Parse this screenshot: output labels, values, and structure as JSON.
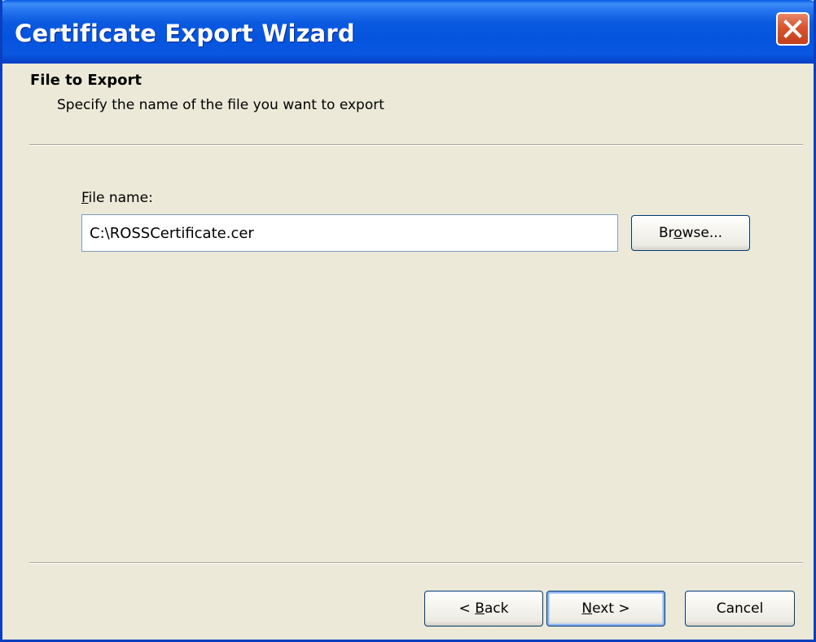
{
  "window": {
    "title": "Certificate Export Wizard"
  },
  "header": {
    "title": "File to Export",
    "subtitle": "Specify the name of the file you want to export"
  },
  "file_field": {
    "label_mnemonic": "F",
    "label_rest": "ile name:",
    "value": "C:\\ROSSCertificate.cer"
  },
  "buttons": {
    "browse": {
      "pre": "Br",
      "mnemonic": "o",
      "post": "wse..."
    },
    "back": {
      "pre": "< ",
      "mnemonic": "B",
      "post": "ack"
    },
    "next": {
      "pre": "",
      "mnemonic": "N",
      "post": "ext >"
    },
    "cancel": {
      "label": "Cancel"
    }
  },
  "colors": {
    "titlebar": "#0554dd",
    "dialog_bg": "#ece9d8",
    "close_button": "#d9532e"
  },
  "icons": {
    "close": "close-icon"
  }
}
